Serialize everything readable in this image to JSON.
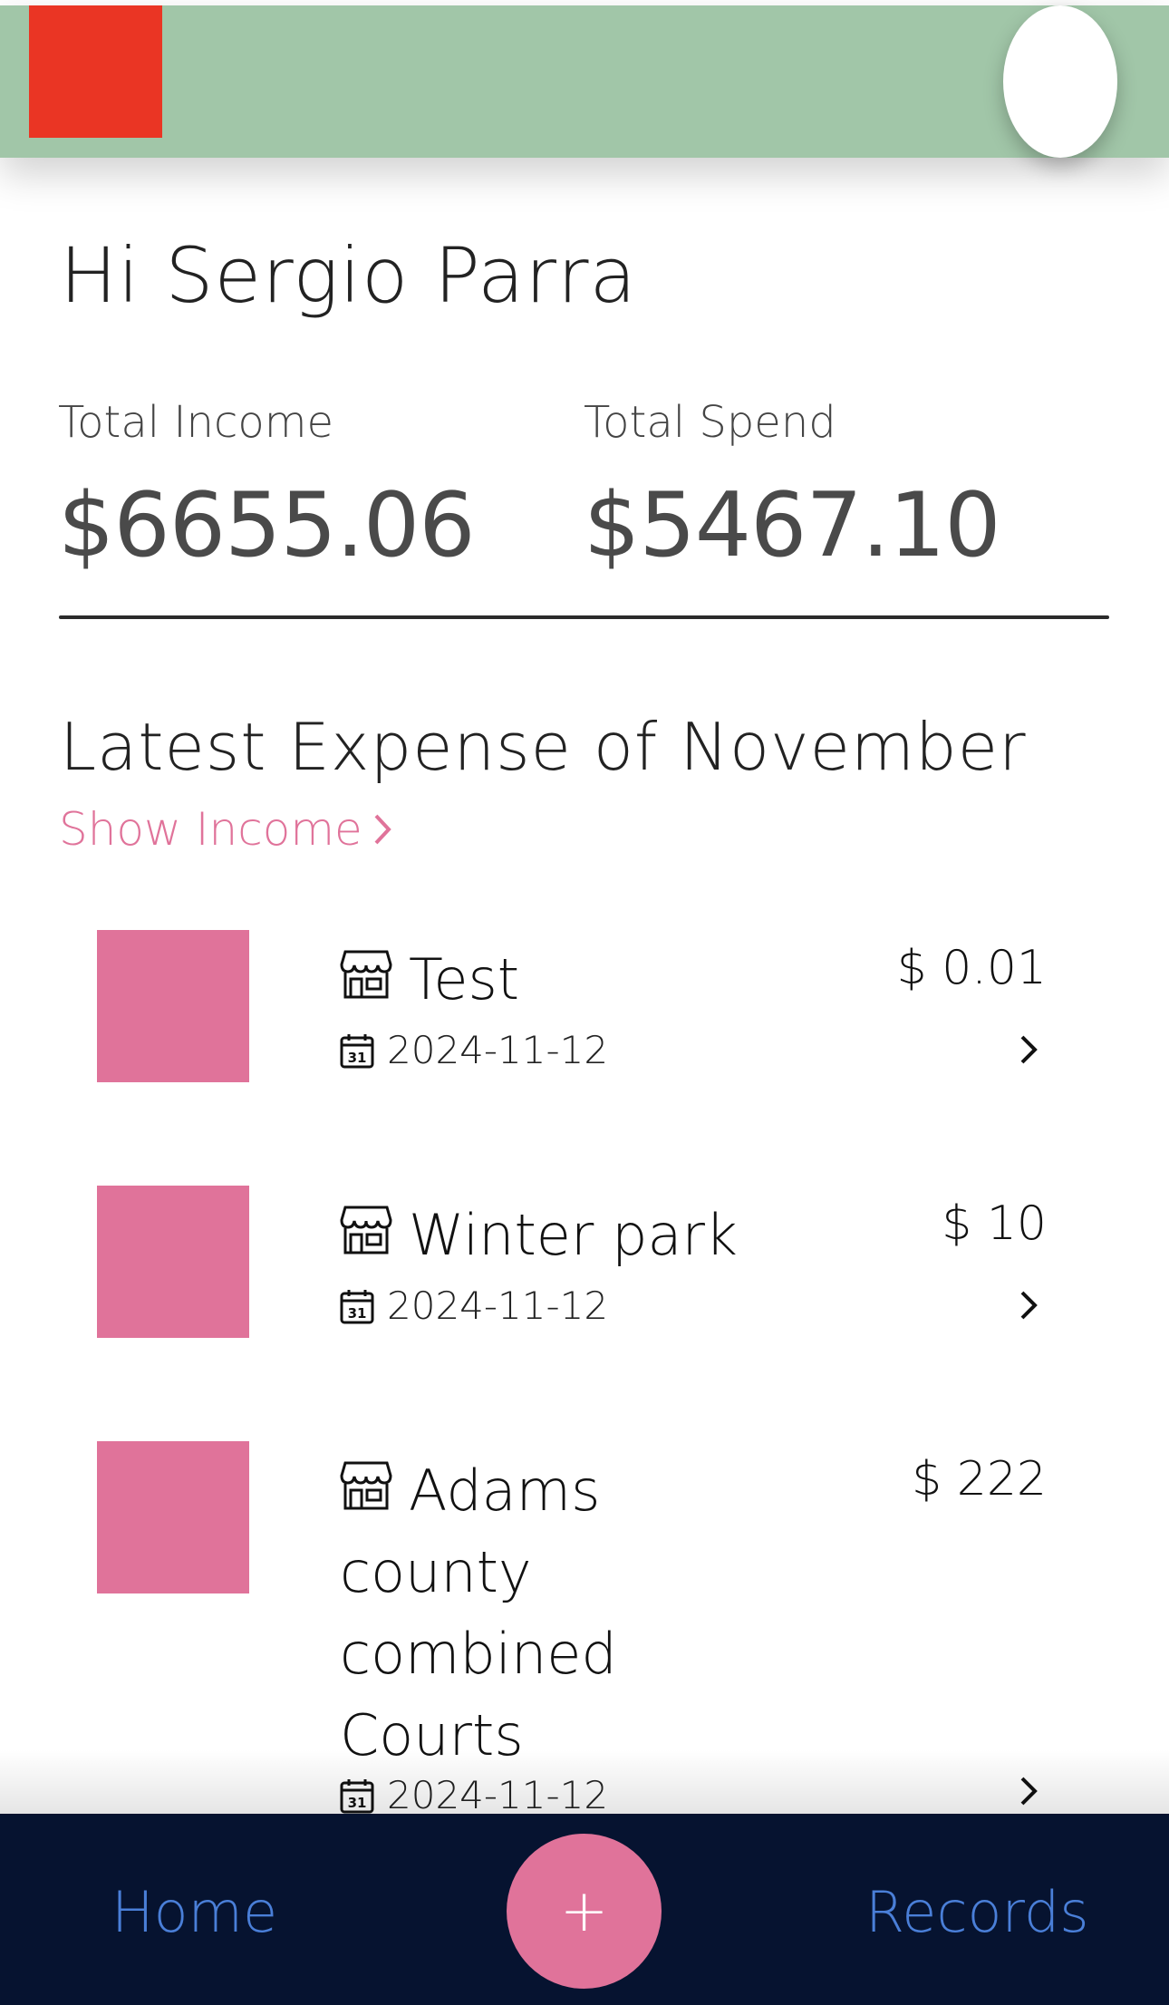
{
  "colors": {
    "header_bg": "#a1c6a8",
    "logo": "#ea3524",
    "accent_pink": "#e0739a",
    "nav_bg": "#061330",
    "nav_text": "#4a7fd8"
  },
  "header": {
    "logo_icon": "app-logo",
    "avatar_icon": "user-avatar"
  },
  "greeting": "Hi Sergio Parra",
  "stats": {
    "income_label": "Total Income",
    "income_value": "$6655.06",
    "spend_label": "Total Spend",
    "spend_value": "$5467.10"
  },
  "section": {
    "title": "Latest Expense of November",
    "toggle_label": "Show Income"
  },
  "expenses": [
    {
      "name": "Test",
      "date": "2024-11-12",
      "amount": "$ 0.01"
    },
    {
      "name": "Winter park",
      "date": "2024-11-12",
      "amount": "$ 10"
    },
    {
      "name": "Adams county combined Courts",
      "date": "2024-11-12",
      "amount": "$ 222"
    }
  ],
  "nav": {
    "home_label": "Home",
    "add_label": "+",
    "records_label": "Records"
  }
}
